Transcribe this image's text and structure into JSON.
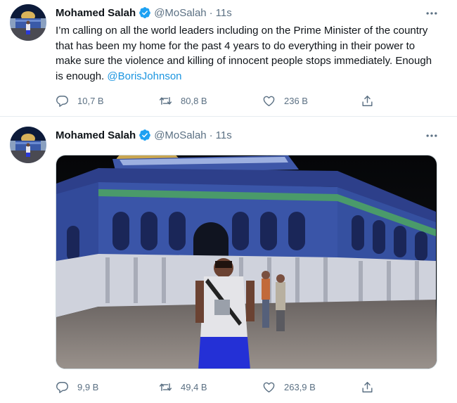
{
  "colors": {
    "accent": "#1b95e0",
    "verified": "#1da1f2",
    "muted": "#5b7083",
    "text": "#0f1419"
  },
  "tweets": [
    {
      "name": "Mohamed Salah",
      "handle": "@MoSalah",
      "separator": "·",
      "time": "11s",
      "text": "I’m calling on all the world leaders including on the Prime Minister of the country that has been my home for the past 4 years to do everything in their power to make sure the violence and killing of innocent people stops immediately. Enough is enough. ",
      "mention": "@BorisJohnson",
      "stats": {
        "replies": "10,7 B",
        "retweets": "80,8 B",
        "likes": "236 B"
      },
      "icons": [
        "verified-badge-icon",
        "more-options-icon",
        "reply-icon",
        "retweet-icon",
        "like-icon",
        "share-icon"
      ]
    },
    {
      "name": "Mohamed Salah",
      "handle": "@MoSalah",
      "separator": "·",
      "time": "11s",
      "stats": {
        "replies": "9,9 B",
        "retweets": "49,4 B",
        "likes": "263,9 B"
      },
      "icons": [
        "verified-badge-icon",
        "more-options-icon",
        "reply-icon",
        "retweet-icon",
        "like-icon",
        "share-icon"
      ]
    }
  ]
}
